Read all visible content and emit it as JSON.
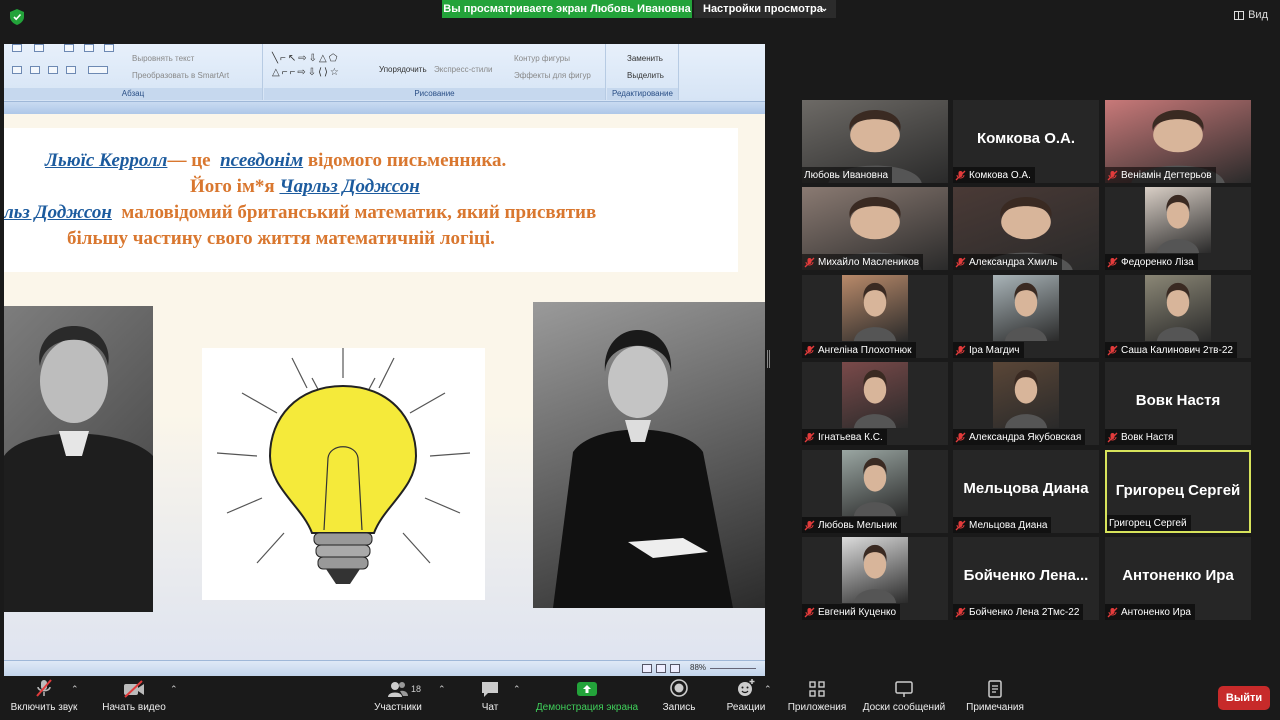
{
  "topbar": {
    "share_banner": "Вы просматриваете экран Любовь Ивановна",
    "view_settings": "Настройки просмотра",
    "view": "Вид"
  },
  "ribbon": {
    "align_text": "Выровнять текст",
    "convert_smartart": "Преобразовать в SmartArt",
    "paragraph": "Абзац",
    "arrange": "Упорядочить",
    "express_styles": "Экспресс-стили",
    "shape_outline": "Контур фигуры",
    "shape_effects": "Эффекты для фигур",
    "drawing": "Рисование",
    "replace": "Заменить",
    "select": "Выделить",
    "editing": "Редактирование"
  },
  "slide": {
    "l1_a": "Льюїс Керролл",
    "l1_b": "— це",
    "l1_c": "псевдонім",
    "l1_d": "відомого письменника.",
    "l2_a": "Його ім*я",
    "l2_b": "Чарльз Доджсон",
    "l3_a": "льз Доджсон",
    "l3_b": "маловідомий британський математик, який присвятив",
    "l4": "більшу частину свого життя математичній логіці."
  },
  "statusbar": {
    "zoom": "88%"
  },
  "participants": [
    {
      "name": "Любовь Ивановна",
      "video": true,
      "bg": "#6d6a66",
      "muted": false
    },
    {
      "name": "Комкова О.А.",
      "big": "Комкова О.А.",
      "video": false,
      "muted": true
    },
    {
      "name": "Веніамін Дегтерьов",
      "video": true,
      "bg": "#c87979",
      "muted": true
    },
    {
      "name": "Михайло Маслеников",
      "video": true,
      "bg": "#8a7a72",
      "muted": true
    },
    {
      "name": "Александра Хмиль",
      "video": true,
      "bg": "#4a3a36",
      "muted": true
    },
    {
      "name": "Федоренко Ліза",
      "video": true,
      "bg": "#d9cfc6",
      "muted": true
    },
    {
      "name": "Ангеліна Плохотнюк",
      "video": true,
      "bg": "#b98a6a",
      "muted": true
    },
    {
      "name": "Іра Магдич",
      "video": true,
      "bg": "#a9b4b8",
      "muted": true
    },
    {
      "name": "Саша Калинович 2тв-22",
      "video": true,
      "bg": "#8b8776",
      "muted": true
    },
    {
      "name": "Ігнатьева К.С.",
      "video": true,
      "bg": "#7a4a4a",
      "muted": true
    },
    {
      "name": "Александра Якубовская",
      "video": true,
      "bg": "#5a4637",
      "muted": true
    },
    {
      "name": "Вовк Настя",
      "big": "Вовк Настя",
      "video": false,
      "muted": true
    },
    {
      "name": "Любовь Мельник",
      "video": true,
      "bg": "#9aa6a2",
      "muted": true
    },
    {
      "name": "Мельцова Диана",
      "big": "Мельцова Диана",
      "video": false,
      "muted": true
    },
    {
      "name": "Григорец Сергей",
      "big": "Григорец Сергей",
      "video": false,
      "muted": false,
      "active": true
    },
    {
      "name": "Евгений Куценко",
      "video": true,
      "bg": "#dcdcdc",
      "muted": true
    },
    {
      "name": "Бойченко Лена 2Тмс-22",
      "big": "Бойченко  Лена...",
      "video": false,
      "muted": true
    },
    {
      "name": "Антоненко Ира",
      "big": "Антоненко Ира",
      "video": false,
      "muted": true
    }
  ],
  "toolbar": {
    "unmute": "Включить звук",
    "start_video": "Начать видео",
    "participants": "Участники",
    "participants_count": "18",
    "chat": "Чат",
    "share": "Демонстрация экрана",
    "record": "Запись",
    "reactions": "Реакции",
    "apps": "Приложения",
    "whiteboards": "Доски сообщений",
    "notes": "Примечания",
    "leave": "Выйти"
  },
  "colors": {
    "share_green": "#23a33a",
    "leave_red": "#c72a2a",
    "active_border": "#d7e35b",
    "slide_orange": "#d9772f",
    "slide_blue": "#1c5b9e"
  }
}
